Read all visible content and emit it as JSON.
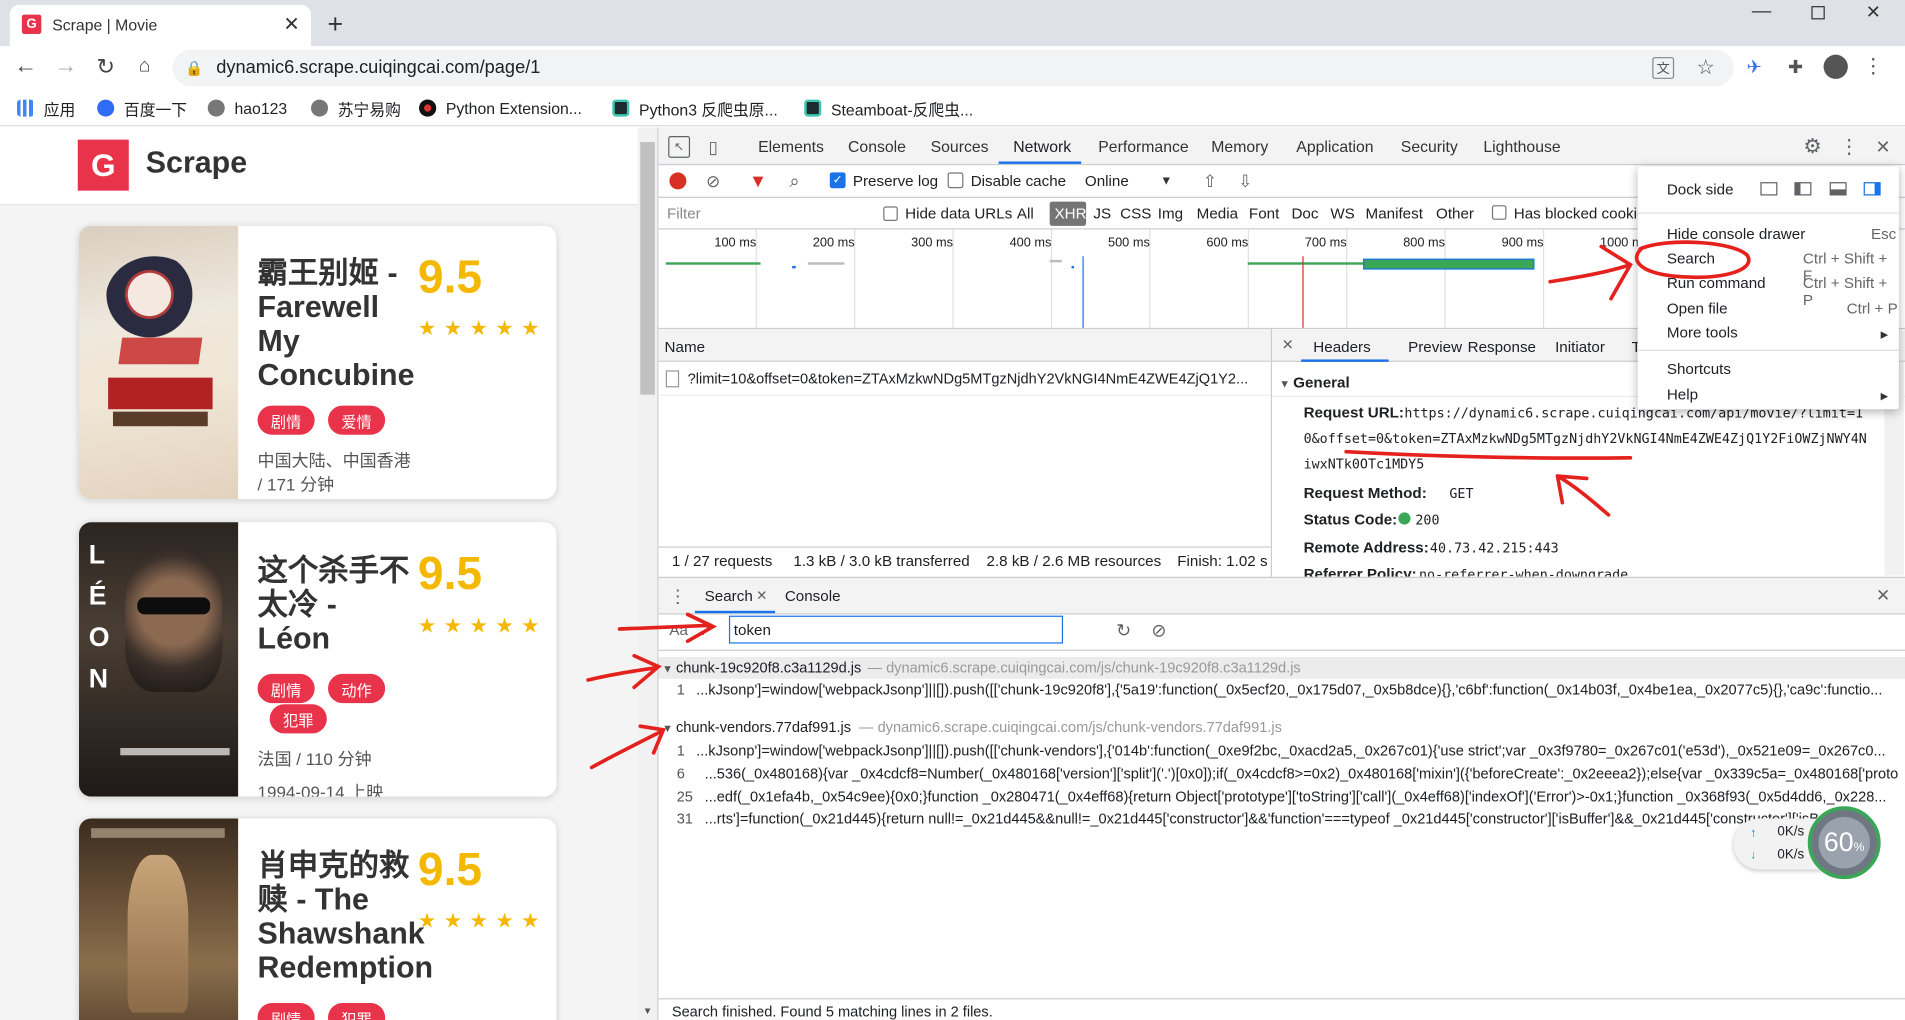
{
  "browser": {
    "tab_title": "Scrape | Movie",
    "url": "dynamic6.scrape.cuiqingcai.com/page/1"
  },
  "bookmarks": [
    "应用",
    "百度一下",
    "hao123",
    "苏宁易购",
    "Python Extension...",
    "Python3 反爬虫原...",
    "Steamboat-反爬虫..."
  ],
  "site": {
    "brand": "Scrape"
  },
  "movies": [
    {
      "title": "霸王别姬 - Farewell My Concubine",
      "score": "9.5",
      "tags": [
        "剧情",
        "爱情"
      ],
      "meta": "中国大陆、中国香港 / 171 分钟"
    },
    {
      "title": "这个杀手不太冷 - Léon",
      "score": "9.5",
      "tags": [
        "剧情",
        "动作",
        "犯罪"
      ],
      "meta": "法国 / 110 分钟",
      "date": "1994-09-14 上映"
    },
    {
      "title": "肖申克的救赎 - The Shawshank Redemption",
      "score": "9.5",
      "tags": [
        "剧情",
        "犯罪"
      ]
    }
  ],
  "devtools": {
    "tabs": [
      "Elements",
      "Console",
      "Sources",
      "Network",
      "Performance",
      "Memory",
      "Application",
      "Security",
      "Lighthouse"
    ],
    "active_tab": "Network",
    "toolbar": {
      "preserve_log": "Preserve log",
      "disable_cache": "Disable cache",
      "throttle": "Online"
    },
    "filter": {
      "placeholder": "Filter",
      "hide_data_urls": "Hide data URLs",
      "types": [
        "All",
        "XHR",
        "JS",
        "CSS",
        "Img",
        "Media",
        "Font",
        "Doc",
        "WS",
        "Manifest",
        "Other"
      ],
      "active_type": "XHR",
      "has_blocked": "Has blocked cookies"
    },
    "timeline_ticks": [
      "100 ms",
      "200 ms",
      "300 ms",
      "400 ms",
      "500 ms",
      "600 ms",
      "700 ms",
      "800 ms",
      "900 ms",
      "1000 ms"
    ],
    "name_header": "Name",
    "request_row": "?limit=10&offset=0&token=ZTAxMzkwNDg5MTgzNjdhY2VkNGI4NmE4ZWE4ZjQ1Y2...",
    "status_bar": {
      "requests": "1 / 27 requests",
      "transferred": "1.3 kB / 3.0 kB transferred",
      "resources": "2.8 kB / 2.6 MB resources",
      "finish": "Finish: 1.02 s"
    },
    "detail_tabs": [
      "Headers",
      "Preview",
      "Response",
      "Initiator",
      "T"
    ],
    "general": {
      "heading": "General",
      "request_url_label": "Request URL:",
      "request_url_line1": "https://dynamic6.scrape.cuiqingcai.com/api/movie/?limit=1",
      "request_url_line2": "0&offset=0&token=ZTAxMzkwNDg5MTgzNjdhY2VkNGI4NmE4ZWE4ZjQ1Y2FiOWZjNWY4N",
      "request_url_line3": "iwxNTk0OTc1MDY5",
      "method_label": "Request Method:",
      "method": "GET",
      "status_label": "Status Code:",
      "status": "200",
      "remote_label": "Remote Address:",
      "remote": "40.73.42.215:443",
      "referrer_label": "Referrer Policy:",
      "referrer": "no-referrer-when-downgrade"
    },
    "menu": {
      "dock_side": "Dock side",
      "items": [
        {
          "label": "Hide console drawer",
          "shortcut": "Esc"
        },
        {
          "label": "Search",
          "shortcut": "Ctrl + Shift + F"
        },
        {
          "label": "Run command",
          "shortcut": "Ctrl + Shift + P"
        },
        {
          "label": "Open file",
          "shortcut": "Ctrl + P"
        },
        {
          "label": "More tools",
          "shortcut": "▸"
        },
        {
          "label": "Shortcuts",
          "shortcut": ""
        },
        {
          "label": "Help",
          "shortcut": "▸"
        }
      ]
    },
    "drawer": {
      "tabs": [
        "Search",
        "Console"
      ],
      "aa": "Aa",
      ".*": ".*",
      "query": "token",
      "results": [
        {
          "file": "chunk-19c920f8.c3a1129d.js",
          "path": "— dynamic6.scrape.cuiqingcai.com/js/chunk-19c920f8.c3a1129d.js",
          "lines": [
            {
              "n": "1",
              "text": "...kJsonp']=window['webpackJsonp']||[]).push([['chunk-19c920f8'],{'5a19':function(_0x5ecf20,_0x175d07,_0x5b8dce){},'c6bf':function(_0x14b03f,_0x4be1ea,_0x2077c5){},'ca9c':functio..."
            }
          ]
        },
        {
          "file": "chunk-vendors.77daf991.js",
          "path": "— dynamic6.scrape.cuiqingcai.com/js/chunk-vendors.77daf991.js",
          "lines": [
            {
              "n": "1",
              "text": "...kJsonp']=window['webpackJsonp']||[]).push([['chunk-vendors'],{'014b':function(_0xe9f2bc,_0xacd2a5,_0x267c01){'use strict';var _0x3f9780=_0x267c01('e53d'),_0x521e09=_0x267c0..."
            },
            {
              "n": "6",
              "text": "...536(_0x480168){var _0x4cdcf8=Number(_0x480168['version']['split']('.')[0x0]);if(_0x4cdcf8>=0x2)_0x480168['mixin']({'beforeCreate':_0x2eeea2});else{var _0x339c5a=_0x480168['proto..."
            },
            {
              "n": "25",
              "text": "...edf(_0x1efa4b,_0x54c9ee){0x0;}function _0x280471(_0x4eff68){return Object['prototype']['toString']['call'](_0x4eff68)['indexOf']('Error')>-0x1;}function _0x368f93(_0x5d4dd6,_0x228..."
            },
            {
              "n": "31",
              "text": "...rts']=function(_0x21d445){return null!=_0x21d445&&null!=_0x21d445['constructor']&&'function'===typeof _0x21d445['constructor']['isBuffer']&&_0x21d445['constructor']['isBuff..."
            }
          ]
        }
      ],
      "status": "Search finished.  Found 5 matching lines in 2 files."
    }
  },
  "widget": {
    "up": "0K/s",
    "down": "0K/s",
    "percent": "60",
    "unit": "%"
  }
}
